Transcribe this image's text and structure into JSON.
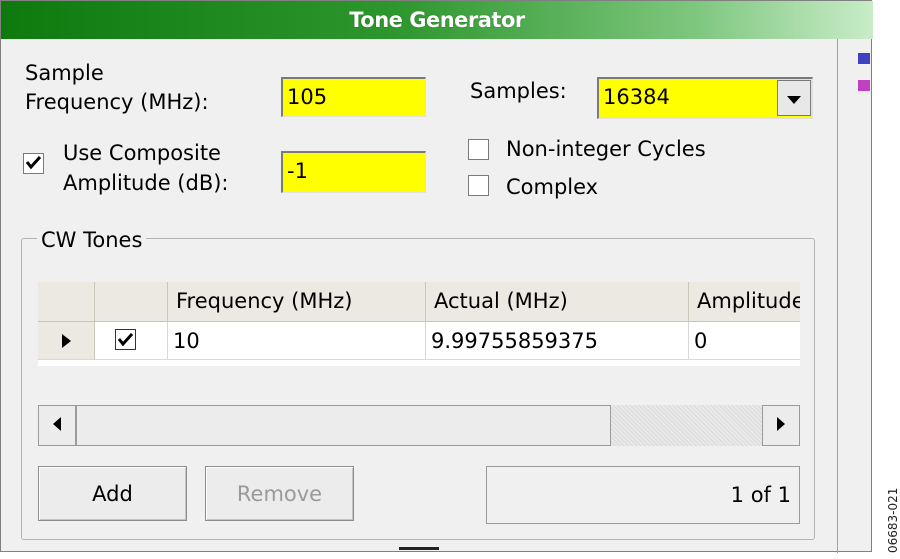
{
  "window": {
    "title": "Tone Generator"
  },
  "settings": {
    "sample_frequency_label_line1": "Sample",
    "sample_frequency_label_line2": "Frequency (MHz):",
    "sample_frequency_value": "105",
    "samples_label": "Samples:",
    "samples_value": "16384",
    "use_composite_checked": true,
    "use_composite_label_line1": "Use Composite",
    "use_composite_label_line2": "Amplitude (dB):",
    "amplitude_value": "-1",
    "non_integer_cycles_label": "Non-integer Cycles",
    "non_integer_cycles_checked": false,
    "complex_label": "Complex",
    "complex_checked": false
  },
  "cw_tones": {
    "group_title": "CW Tones",
    "columns": [
      "Frequency (MHz)",
      "Actual (MHz)",
      "Amplitude"
    ],
    "rows": [
      {
        "enabled": true,
        "frequency": "10",
        "actual": "9.99755859375",
        "amplitude": "0"
      }
    ],
    "add_label": "Add",
    "remove_label": "Remove",
    "counter_text": "1 of 1"
  },
  "figure_id": "06683-021",
  "colors": {
    "title_green": "#1e8a1e",
    "field_yellow": "#ffff00"
  }
}
